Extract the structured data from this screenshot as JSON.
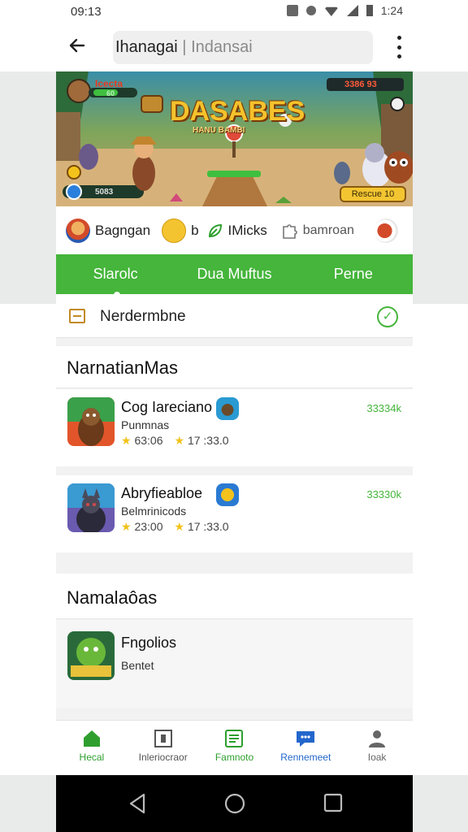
{
  "status_bar": {
    "time": "09:13",
    "battery_text": "1:24"
  },
  "app_bar": {
    "search_value": "Ihanagai",
    "search_hint": "Indansai"
  },
  "banner": {
    "promo_title": "DASABES",
    "promo_subtitle": "HANU BAMBI",
    "hud_left_label": "Icecta",
    "hud_left_value": "60",
    "hud_right_label": "3386 93",
    "hud_bottom_value": "5083",
    "cta_label": "Rescue 10"
  },
  "categories": [
    {
      "label": "Bagngan"
    },
    {
      "label": "b"
    },
    {
      "label": "IMicks"
    },
    {
      "label": "bamroan"
    }
  ],
  "tabs": [
    {
      "label": "Slarolc",
      "active": true
    },
    {
      "label": "Dua Muftus",
      "active": false
    },
    {
      "label": "Perne",
      "active": false
    }
  ],
  "filter": {
    "label": "Nerdermbne"
  },
  "sections": [
    {
      "title": "NarnatianMas",
      "items": [
        {
          "name": "Cog Iareciano",
          "subtitle": "Punmnas",
          "rating": "63:06",
          "reviews": "17 :33.0",
          "count": "33334k"
        },
        {
          "name": "Abryfieabloe",
          "subtitle": "Belmrinicods",
          "rating": "23:00",
          "reviews": "17 :33.0",
          "count": "33330k"
        }
      ]
    },
    {
      "title": "Namalaôas",
      "items": [
        {
          "name": "Fngolios",
          "subtitle": "Bentet"
        }
      ]
    }
  ],
  "bottom_nav": [
    {
      "label": "Hecal",
      "icon": "home-icon",
      "color": "#2e9f2e"
    },
    {
      "label": "Inleriocraor",
      "icon": "document-icon",
      "color": "#555555"
    },
    {
      "label": "Famnoto",
      "icon": "list-icon",
      "color": "#2e9f2e"
    },
    {
      "label": "Rennemeet",
      "icon": "chat-icon",
      "color": "#2266cc"
    },
    {
      "label": "Ioak",
      "icon": "person-icon",
      "color": "#666666"
    }
  ],
  "colors": {
    "accent": "#45b53b",
    "tab_bar": "#45b53b",
    "count_text": "#45b53b",
    "star": "#f3c21b"
  }
}
